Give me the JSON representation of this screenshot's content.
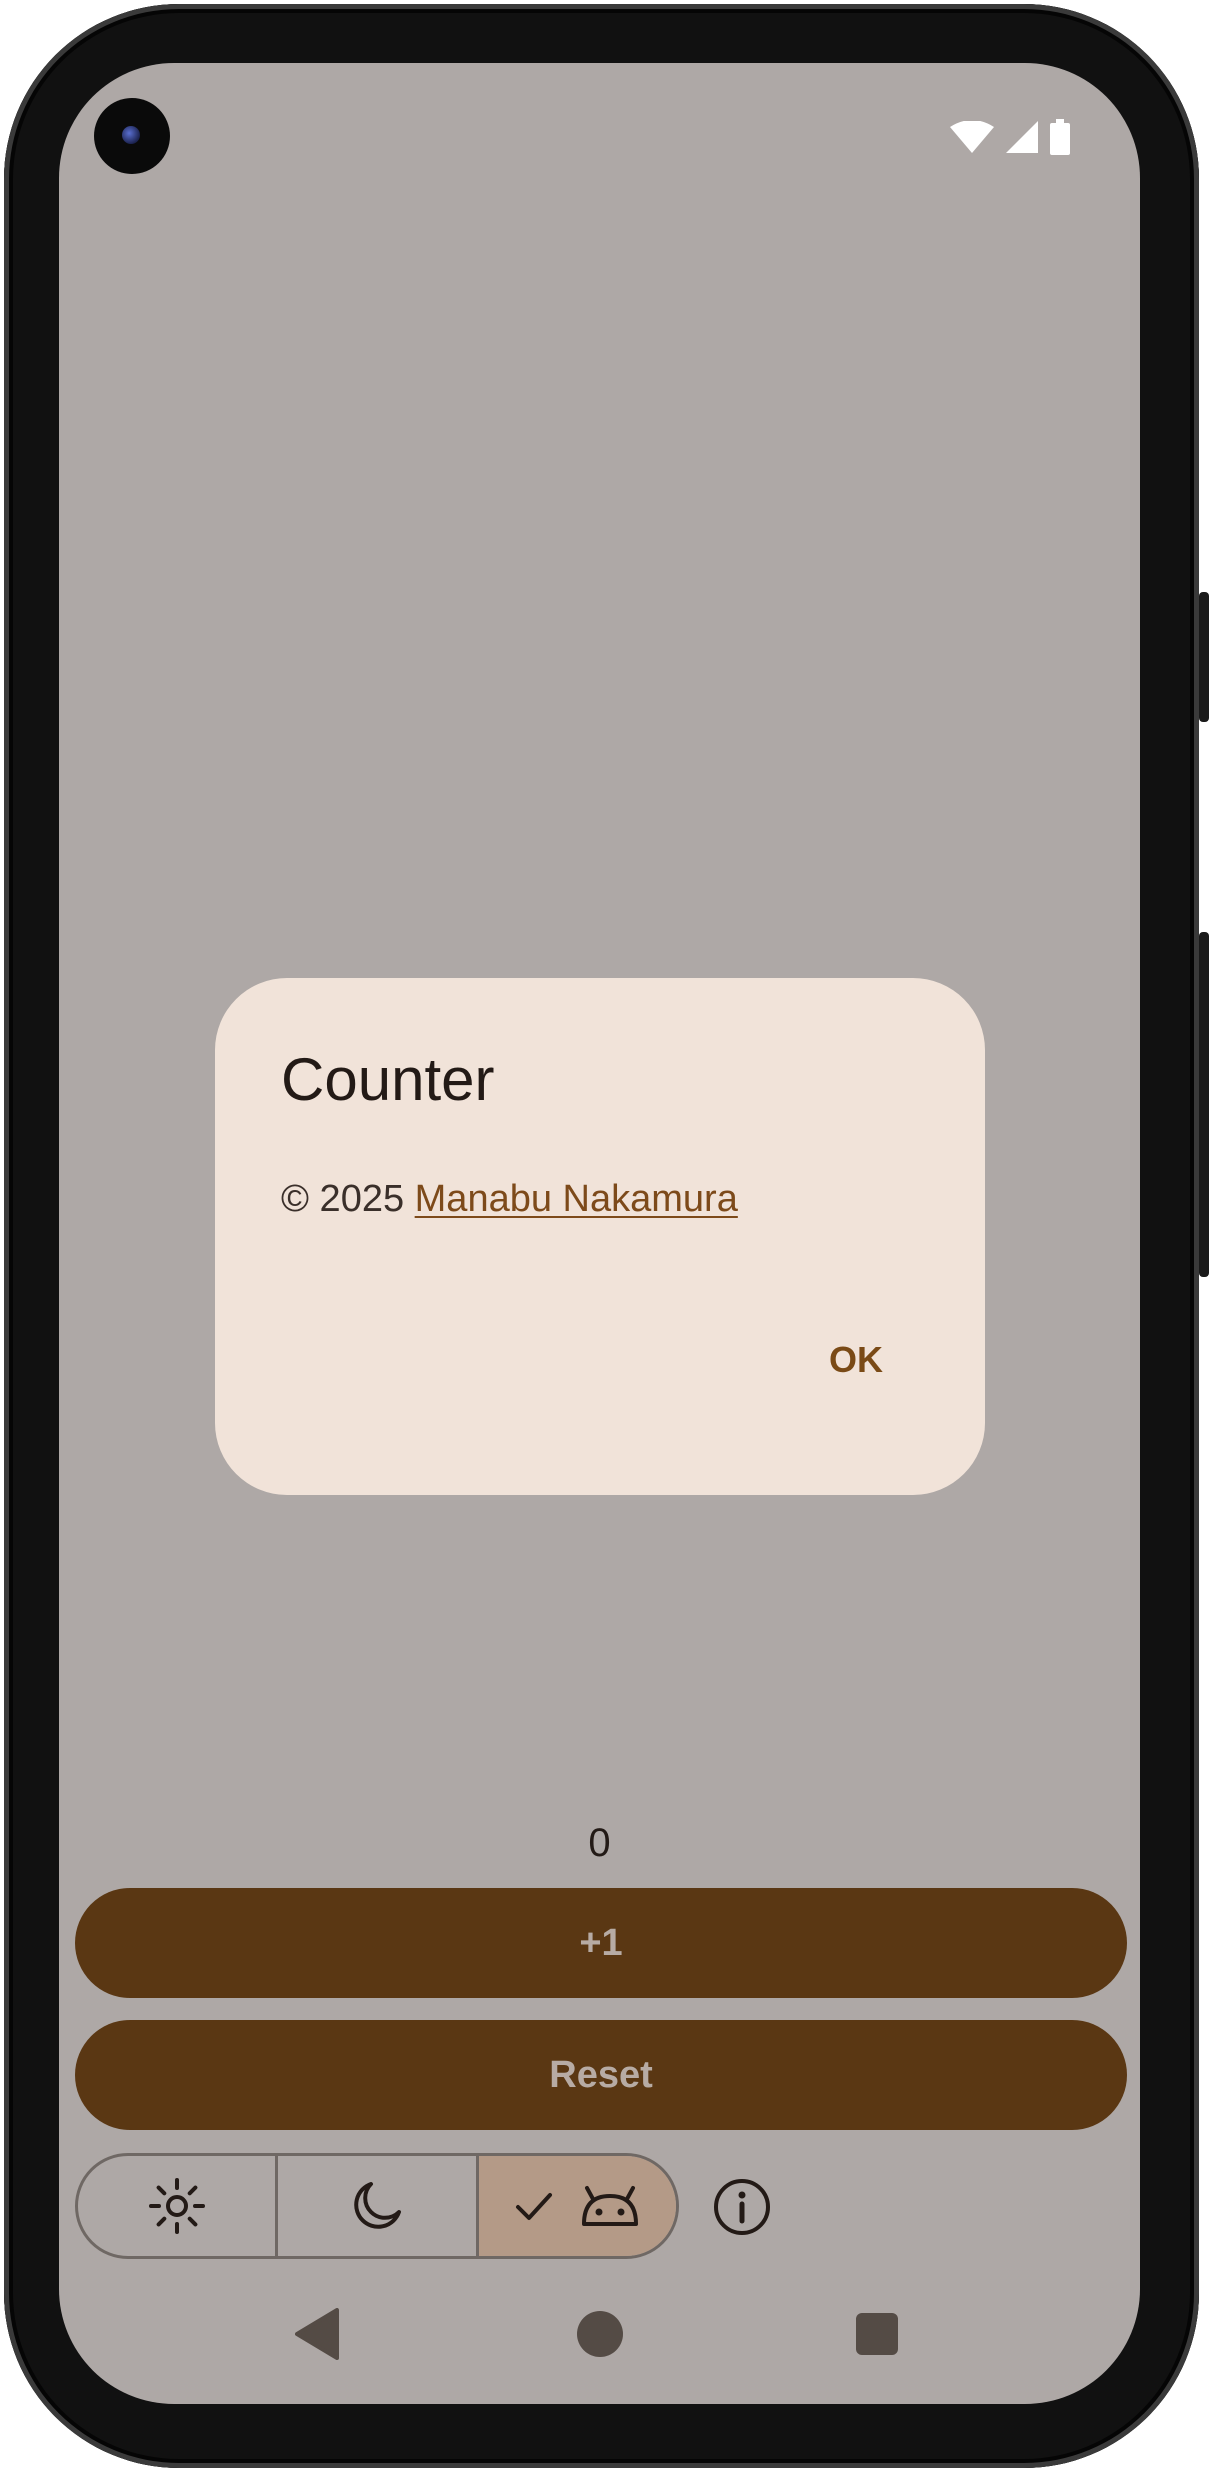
{
  "device": {
    "status_bar": {
      "icons": [
        "wifi-icon",
        "cellular-signal-icon",
        "battery-icon"
      ]
    }
  },
  "dialog": {
    "title": "Counter",
    "copyright_prefix": "© 2025 ",
    "author_link": "Manabu Nakamura",
    "ok_label": "OK"
  },
  "main": {
    "count": "0",
    "increment_label": "+1",
    "reset_label": "Reset"
  },
  "theme_selector": {
    "options": [
      {
        "icon": "sun-icon",
        "meaning": "light",
        "selected": false
      },
      {
        "icon": "moon-icon",
        "meaning": "dark",
        "selected": false
      },
      {
        "icon": "android-icon",
        "meaning": "system",
        "selected": true
      }
    ]
  },
  "info_icon": "info-icon",
  "colors": {
    "screen_background": "#aea8a6",
    "dialog_background": "#f1e3d9",
    "primary_button": "#5a3713",
    "link": "#7d4a1a",
    "selected_segment": "#b49a87"
  },
  "nav_bar": {
    "icons": [
      "back-icon",
      "home-icon",
      "recents-icon"
    ]
  }
}
